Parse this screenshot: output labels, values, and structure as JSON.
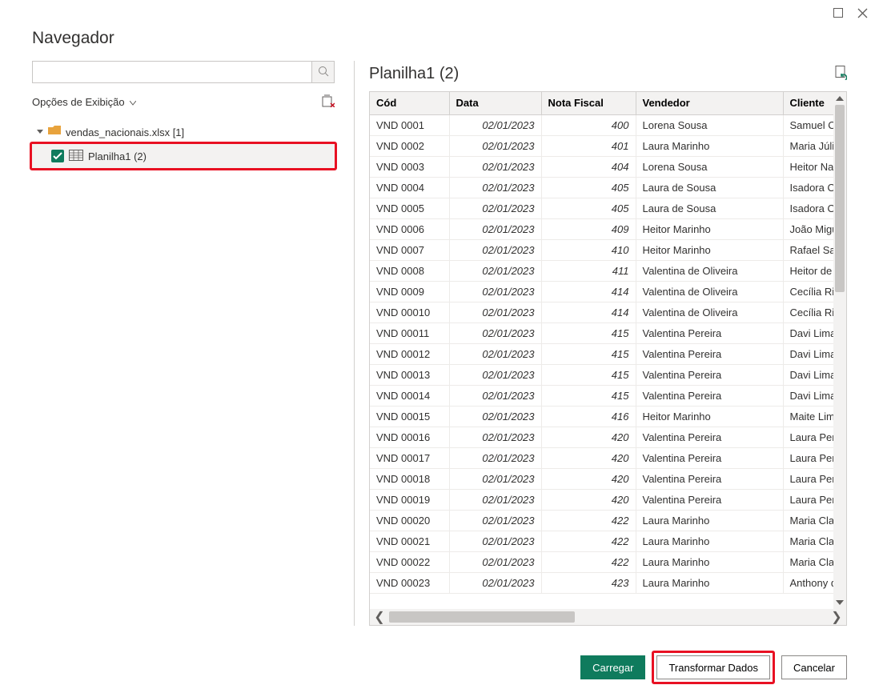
{
  "dialog": {
    "title": "Navegador"
  },
  "left": {
    "display_options_label": "Opções de Exibição",
    "file_label": "vendas_nacionais.xlsx [1]",
    "sheet_label": "Planilha1 (2)"
  },
  "preview": {
    "title": "Planilha1 (2)",
    "columns": [
      "Cód",
      "Data",
      "Nota Fiscal",
      "Vendedor",
      "Cliente"
    ],
    "rows": [
      {
        "cod": "VND 0001",
        "data": "02/01/2023",
        "nf": "400",
        "vend": "Lorena Sousa",
        "cli": "Samuel Co"
      },
      {
        "cod": "VND 0002",
        "data": "02/01/2023",
        "nf": "401",
        "vend": "Laura Marinho",
        "cli": "Maria Júlia"
      },
      {
        "cod": "VND 0003",
        "data": "02/01/2023",
        "nf": "404",
        "vend": "Lorena Sousa",
        "cli": "Heitor Nas"
      },
      {
        "cod": "VND 0004",
        "data": "02/01/2023",
        "nf": "405",
        "vend": "Laura de Sousa",
        "cli": "Isadora Oli"
      },
      {
        "cod": "VND 0005",
        "data": "02/01/2023",
        "nf": "405",
        "vend": "Laura de Sousa",
        "cli": "Isadora Oli"
      },
      {
        "cod": "VND 0006",
        "data": "02/01/2023",
        "nf": "409",
        "vend": "Heitor Marinho",
        "cli": "João Migu"
      },
      {
        "cod": "VND 0007",
        "data": "02/01/2023",
        "nf": "410",
        "vend": "Heitor Marinho",
        "cli": "Rafael Safr"
      },
      {
        "cod": "VND 0008",
        "data": "02/01/2023",
        "nf": "411",
        "vend": "Valentina de Oliveira",
        "cli": "Heitor de A"
      },
      {
        "cod": "VND 0009",
        "data": "02/01/2023",
        "nf": "414",
        "vend": "Valentina de Oliveira",
        "cli": "Cecília Rib"
      },
      {
        "cod": "VND 00010",
        "data": "02/01/2023",
        "nf": "414",
        "vend": "Valentina de Oliveira",
        "cli": "Cecília Rib"
      },
      {
        "cod": "VND 00011",
        "data": "02/01/2023",
        "nf": "415",
        "vend": "Valentina Pereira",
        "cli": "Davi Lima"
      },
      {
        "cod": "VND 00012",
        "data": "02/01/2023",
        "nf": "415",
        "vend": "Valentina Pereira",
        "cli": "Davi Lima"
      },
      {
        "cod": "VND 00013",
        "data": "02/01/2023",
        "nf": "415",
        "vend": "Valentina Pereira",
        "cli": "Davi Lima"
      },
      {
        "cod": "VND 00014",
        "data": "02/01/2023",
        "nf": "415",
        "vend": "Valentina Pereira",
        "cli": "Davi Lima"
      },
      {
        "cod": "VND 00015",
        "data": "02/01/2023",
        "nf": "416",
        "vend": "Heitor Marinho",
        "cli": "Maite Lima"
      },
      {
        "cod": "VND 00016",
        "data": "02/01/2023",
        "nf": "420",
        "vend": "Valentina Pereira",
        "cli": "Laura Pere"
      },
      {
        "cod": "VND 00017",
        "data": "02/01/2023",
        "nf": "420",
        "vend": "Valentina Pereira",
        "cli": "Laura Pere"
      },
      {
        "cod": "VND 00018",
        "data": "02/01/2023",
        "nf": "420",
        "vend": "Valentina Pereira",
        "cli": "Laura Pere"
      },
      {
        "cod": "VND 00019",
        "data": "02/01/2023",
        "nf": "420",
        "vend": "Valentina Pereira",
        "cli": "Laura Pere"
      },
      {
        "cod": "VND 00020",
        "data": "02/01/2023",
        "nf": "422",
        "vend": "Laura Marinho",
        "cli": "Maria Clar"
      },
      {
        "cod": "VND 00021",
        "data": "02/01/2023",
        "nf": "422",
        "vend": "Laura Marinho",
        "cli": "Maria Clar"
      },
      {
        "cod": "VND 00022",
        "data": "02/01/2023",
        "nf": "422",
        "vend": "Laura Marinho",
        "cli": "Maria Clar"
      },
      {
        "cod": "VND 00023",
        "data": "02/01/2023",
        "nf": "423",
        "vend": "Laura Marinho",
        "cli": "Anthony d"
      }
    ]
  },
  "footer": {
    "load": "Carregar",
    "transform": "Transformar Dados",
    "cancel": "Cancelar"
  }
}
